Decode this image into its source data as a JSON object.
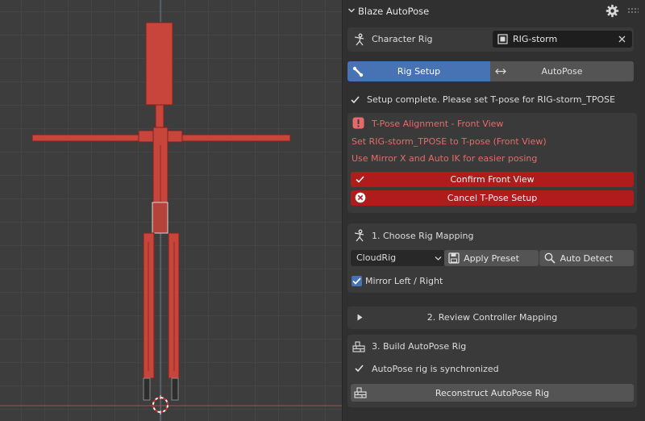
{
  "panel": {
    "title": "Blaze AutoPose",
    "character_rig_label": "Character Rig",
    "character_rig_value": "RIG-storm",
    "tabs": [
      {
        "label": "Rig Setup",
        "active": true
      },
      {
        "label": "AutoPose",
        "active": false
      }
    ],
    "setup_status": "Setup complete. Please set T-pose for RIG-storm_TPOSE",
    "alert": {
      "title": "T-Pose Alignment - Front View",
      "line1": "Set RIG-storm_TPOSE to T-pose (Front View)",
      "line2": "Use Mirror X and Auto IK for easier posing",
      "confirm_label": "Confirm Front View",
      "cancel_label": "Cancel T-Pose Setup"
    },
    "section1": {
      "title": "1. Choose Rig Mapping",
      "dropdown_value": "CloudRig",
      "apply_preset_label": "Apply Preset",
      "auto_detect_label": "Auto Detect",
      "mirror_label": "Mirror Left / Right",
      "mirror_checked": true
    },
    "section2": {
      "title": "2. Review Controller Mapping"
    },
    "section3": {
      "title": "3. Build AutoPose Rig",
      "status": "AutoPose rig is synchronized",
      "reconstruct_label": "Reconstruct AutoPose Rig"
    }
  },
  "colors": {
    "accent_blue": "#4772b3",
    "danger_red": "#b01c1c",
    "warning_text": "#e66a6a",
    "bone_red": "#c8453c"
  }
}
